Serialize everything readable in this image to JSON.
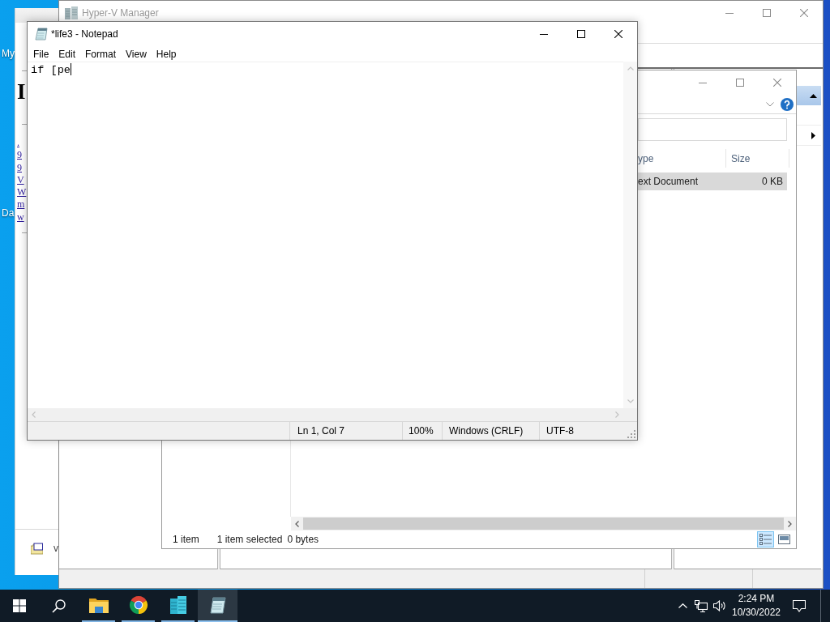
{
  "desktop": {
    "icon_labels": [
      "My",
      "Da"
    ]
  },
  "browser_window": {
    "heading": "I",
    "links": [
      ".",
      "9",
      "9",
      "V",
      "W",
      "m",
      "w"
    ],
    "file_label": "v"
  },
  "hyperv_window": {
    "title": "Hyper-V Manager",
    "active": false
  },
  "explorer_window": {
    "active": false,
    "columns": [
      "ype",
      "Size"
    ],
    "rows": [
      {
        "type": "ext Document",
        "size": "0 KB",
        "selected": true
      }
    ],
    "status": {
      "item_count": "1 item",
      "selection": "1 item selected",
      "selection_size": "0 bytes"
    },
    "views": [
      {
        "kind": "details",
        "selected": true
      },
      {
        "kind": "large_icons",
        "selected": false
      }
    ]
  },
  "notepad_window": {
    "title": "*life3 - Notepad",
    "active": true,
    "menu": [
      "File",
      "Edit",
      "Format",
      "View",
      "Help"
    ],
    "text": "if [pe",
    "status": [
      "Ln 1, Col 7",
      "100%",
      "Windows (CRLF)",
      "UTF-8"
    ]
  },
  "taskbar": {
    "apps": [
      {
        "kind": "explorer",
        "running": true,
        "active": false
      },
      {
        "kind": "chrome",
        "running": true,
        "active": false
      },
      {
        "kind": "hyperv",
        "running": true,
        "active": false
      },
      {
        "kind": "notepad",
        "running": true,
        "active": true
      }
    ],
    "time": "2:24 PM",
    "date": "10/30/2022"
  }
}
